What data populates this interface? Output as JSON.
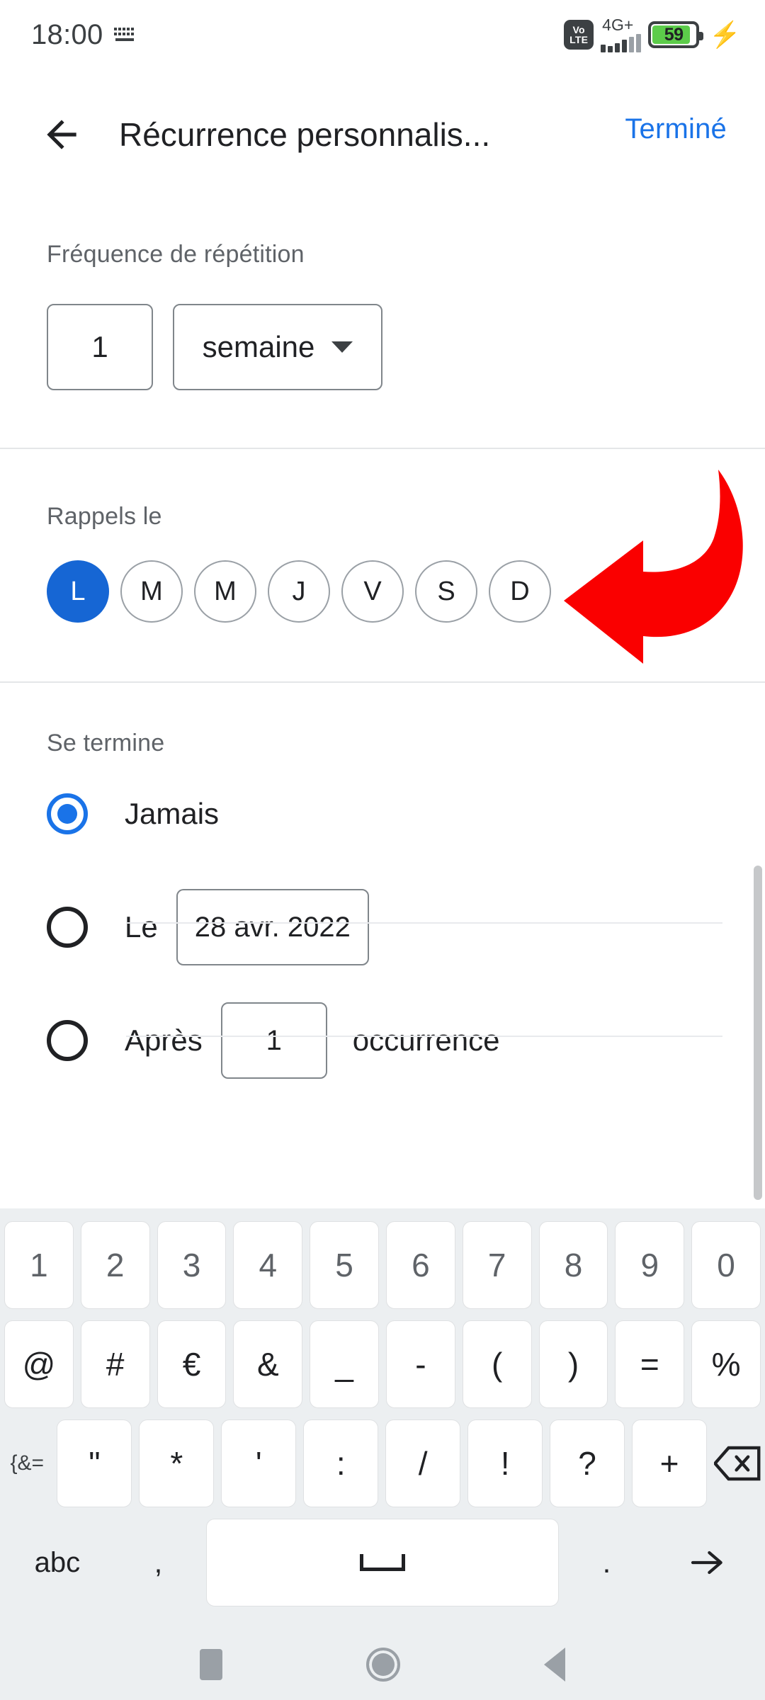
{
  "status_bar": {
    "time": "18:00",
    "keyboard_icon": "keyboard-icon",
    "volte_top": "Vo",
    "volte_bottom": "LTE",
    "network": "4G+",
    "battery_percent": "59",
    "charging_icon": "bolt-icon"
  },
  "appbar": {
    "back_icon": "back-arrow-icon",
    "title": "Récurrence personnalis...",
    "done_label": "Terminé"
  },
  "frequency": {
    "label": "Fréquence de répétition",
    "interval_value": "1",
    "unit_value": "semaine",
    "caret_icon": "chevron-down-icon"
  },
  "days": {
    "label": "Rappels le",
    "items": [
      {
        "letter": "L",
        "selected": true
      },
      {
        "letter": "M",
        "selected": false
      },
      {
        "letter": "M",
        "selected": false
      },
      {
        "letter": "J",
        "selected": false
      },
      {
        "letter": "V",
        "selected": false
      },
      {
        "letter": "S",
        "selected": false
      },
      {
        "letter": "D",
        "selected": false
      }
    ]
  },
  "annotation": {
    "arrow_color": "#fa0000",
    "arrow_icon": "red-curved-arrow-pointing-left"
  },
  "ends": {
    "label": "Se termine",
    "never_label": "Jamais",
    "never_selected": true,
    "on_label": "Le",
    "on_date": "28 avr. 2022",
    "on_selected": false,
    "after_label": "Après",
    "after_count": "1",
    "after_suffix": "occurrence",
    "after_selected": false
  },
  "colors": {
    "accent_blue": "#1a73e8",
    "selected_day_blue": "#1666d4",
    "annotation_red": "#fa0000",
    "battery_green": "#5ccc4a"
  },
  "keyboard": {
    "row1": [
      "1",
      "2",
      "3",
      "4",
      "5",
      "6",
      "7",
      "8",
      "9",
      "0"
    ],
    "row2": [
      "@",
      "#",
      "€",
      "&",
      "_",
      "-",
      "(",
      ")",
      "=",
      "%"
    ],
    "row3_toggle": "{&=",
    "row3": [
      "\"",
      "*",
      "'",
      ":",
      "/",
      "!",
      "?",
      "+"
    ],
    "row3_backspace": "backspace-icon",
    "row4_abc": "abc",
    "row4_comma": ",",
    "row4_space": "space-bar-icon",
    "row4_period": ".",
    "row4_enter": "enter-arrow-icon"
  },
  "navbar": {
    "recents": "square-recents-icon",
    "home": "circle-home-icon",
    "back": "triangle-back-icon"
  }
}
